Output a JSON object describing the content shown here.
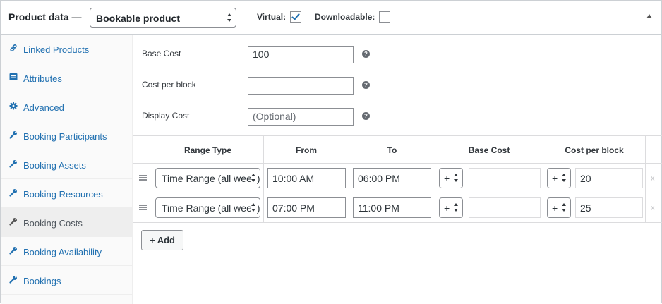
{
  "header": {
    "title": "Product data —",
    "product_type": "Bookable product",
    "virtual_label": "Virtual:",
    "virtual_checked": true,
    "downloadable_label": "Downloadable:",
    "downloadable_checked": false
  },
  "sidebar": {
    "items": [
      {
        "label": "Linked Products",
        "icon": "link-icon",
        "active": false
      },
      {
        "label": "Attributes",
        "icon": "list-icon",
        "active": false
      },
      {
        "label": "Advanced",
        "icon": "gear-icon",
        "active": false
      },
      {
        "label": "Booking Participants",
        "icon": "wrench-icon",
        "active": false
      },
      {
        "label": "Booking Assets",
        "icon": "wrench-icon",
        "active": false
      },
      {
        "label": "Booking Resources",
        "icon": "wrench-icon",
        "active": false
      },
      {
        "label": "Booking Costs",
        "icon": "wrench-icon",
        "active": true
      },
      {
        "label": "Booking Availability",
        "icon": "wrench-icon",
        "active": false
      },
      {
        "label": "Bookings",
        "icon": "wrench-icon",
        "active": false
      }
    ]
  },
  "fields": {
    "base_cost": {
      "label": "Base Cost",
      "value": "100"
    },
    "cost_per_block": {
      "label": "Cost per block",
      "value": ""
    },
    "display_cost": {
      "label": "Display Cost",
      "placeholder": "(Optional)"
    }
  },
  "table": {
    "headers": [
      "Range Type",
      "From",
      "To",
      "Base Cost",
      "Cost per block"
    ],
    "rows": [
      {
        "range_type": "Time Range (all week)",
        "from": "10:00 AM",
        "to": "06:00 PM",
        "base_op": "+",
        "base_cost": "",
        "block_op": "+",
        "block_cost": "20",
        "delete": "x"
      },
      {
        "range_type": "Time Range (all week)",
        "from": "07:00 PM",
        "to": "11:00 PM",
        "base_op": "+",
        "base_cost": "",
        "block_op": "+",
        "block_cost": "25",
        "delete": "x"
      }
    ],
    "add_label": "+ Add"
  },
  "colors": {
    "link": "#2271b1",
    "active_bg": "#eeeeee",
    "border": "#dcdcde"
  }
}
